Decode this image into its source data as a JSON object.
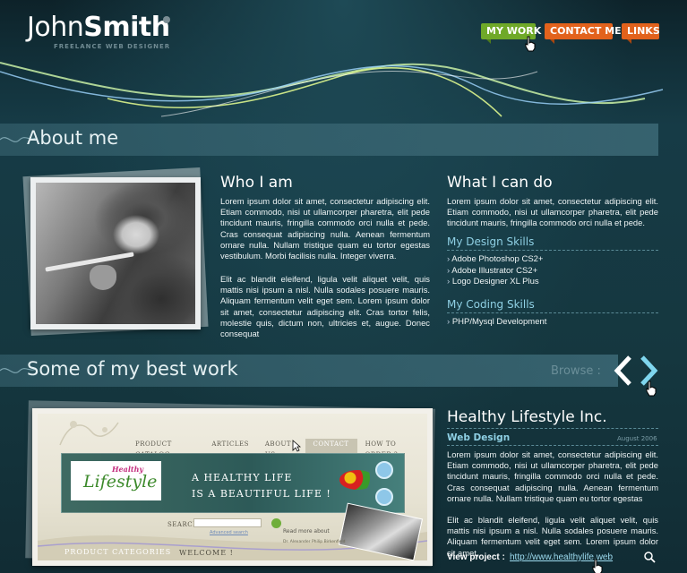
{
  "logo": {
    "name_light": "John",
    "name_bold": "Smith",
    "tagline": "FREELANCE WEB DESIGNER"
  },
  "nav": {
    "items": [
      {
        "label": "MY WORK",
        "color": "#6fa928"
      },
      {
        "label": "CONTACT ME",
        "color": "#e2621c"
      },
      {
        "label": "LINKS",
        "color": "#e2621c"
      }
    ]
  },
  "about": {
    "section_title": "About me",
    "who_title": "Who I am",
    "who_p1": "Lorem ipsum dolor sit amet, consectetur adipiscing elit. Etiam commodo, nisi ut ullamcorper pharetra, elit pede tincidunt mauris, fringilla commodo orci nulla et pede. Cras consequat adipiscing nulla. Aenean fermentum ornare nulla. Nullam tristique quam eu tortor egestas vestibulum. Morbi facilisis nulla. Integer viverra.",
    "who_p2": "Elit ac blandit eleifend, ligula velit aliquet velit, quis mattis nisi ipsum a nisl. Nulla sodales posuere mauris. Aliquam fermentum velit eget sem. Lorem ipsum dolor sit amet, consectetur adipiscing elit. Cras tortor felis, molestie quis, dictum non, ultricies et, augue. Donec consequat",
    "can_title": "What I can do",
    "can_p1": "Lorem ipsum dolor sit amet, consectetur adipiscing elit. Etiam commodo, nisi ut ullamcorper pharetra, elit pede tincidunt mauris, fringilla commodo orci nulla et pede.",
    "design_skills_title": "My Design Skills",
    "design_skills": [
      "Adobe Photoshop CS2+",
      "Adobe Illustrator CS2+",
      "Logo Designer XL Plus"
    ],
    "coding_skills_title": "My Coding Skills",
    "coding_skills": [
      "PHP/Mysql Development"
    ]
  },
  "work": {
    "section_title": "Some of my best work",
    "browse_label": "Browse :",
    "screenshot": {
      "nav": [
        "PRODUCT CATALOG",
        "ARTICLES",
        "ABOUT US",
        "CONTACT",
        "HOW TO ORDER ?"
      ],
      "logo_small": "Healthy",
      "logo_main": "Lifestyle",
      "slogan_1": "A HEALTHY LIFE",
      "slogan_2": "IS A BEAUTIFUL LIFE !",
      "search_label": "SEARCH",
      "advanced_search": "Advanced search",
      "read_more": "Read more about",
      "author": "Dr. Alexander Philip Birkenfield",
      "categories": "PRODUCT CATEGORIES",
      "welcome": "WELCOME !"
    },
    "project_title": "Healthy Lifestyle Inc.",
    "project_type": "Web Design",
    "project_date": "August 2006",
    "project_p1": "Lorem ipsum dolor sit amet, consectetur adipiscing elit. Etiam commodo, nisi ut ullamcorper pharetra, elit pede tincidunt mauris, fringilla commodo orci nulla et pede. Cras consequat adipiscing nulla. Aenean fermentum ornare nulla. Nullam tristique quam eu tortor egestas",
    "project_p2": "Elit ac blandit eleifend, ligula velit aliquet velit, quis mattis nisi ipsum a nisl. Nulla sodales posuere mauris. Aliquam fermentum velit eget sem. Lorem ipsum dolor sit amet,",
    "view_label": "View project :",
    "view_link": "http://www.healthylife.web"
  },
  "colors": {
    "background": "#133640",
    "accent_blue": "#8fd0e4",
    "nav_green": "#6fa928",
    "nav_orange": "#e2621c"
  }
}
